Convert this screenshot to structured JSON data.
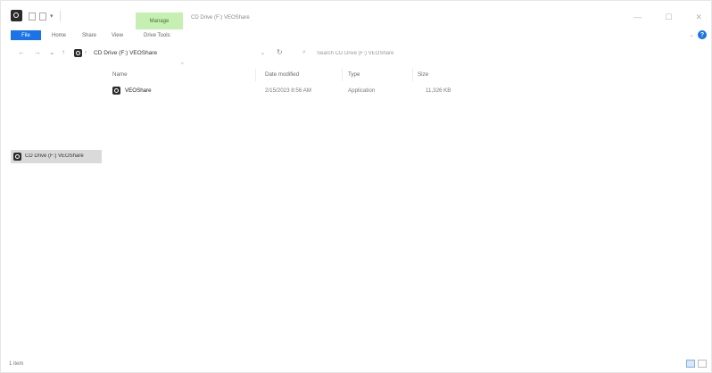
{
  "window": {
    "title_path": "CD Drive (F:) VEOShare",
    "manage_tab": "Manage",
    "controls": {
      "minimize": "—",
      "maximize": "☐",
      "close": "✕"
    }
  },
  "ribbon": {
    "tabs": [
      "File",
      "Home",
      "Share",
      "View",
      "Drive Tools"
    ],
    "help": "?"
  },
  "address": {
    "back": "←",
    "forward": "→",
    "recent": "⌄",
    "up": "↑",
    "separator": "›",
    "path": "CD Drive (F:) VEOShare",
    "dropdown": "⌄",
    "refresh": "↻"
  },
  "search": {
    "glyph": "⌕",
    "placeholder": "Search CD Drive (F:) VEOShare"
  },
  "columns": {
    "name": "Name",
    "date": "Date modified",
    "type": "Type",
    "size": "Size"
  },
  "files": [
    {
      "name": "VEOShare",
      "date": "2/15/2023 8:56 AM",
      "type": "Application",
      "size": "11,326 KB"
    }
  ],
  "drag_ghost": {
    "label": "CD Drive (F:) VEOShare"
  },
  "status": {
    "count": "1 item"
  },
  "icons": {
    "app": "cd-drive-icon",
    "file": "application-icon",
    "help": "help-icon"
  },
  "colors": {
    "file_tab": "#1a73e8",
    "manage_tab": "#c6efb3",
    "drag_ghost": "#dadada"
  }
}
